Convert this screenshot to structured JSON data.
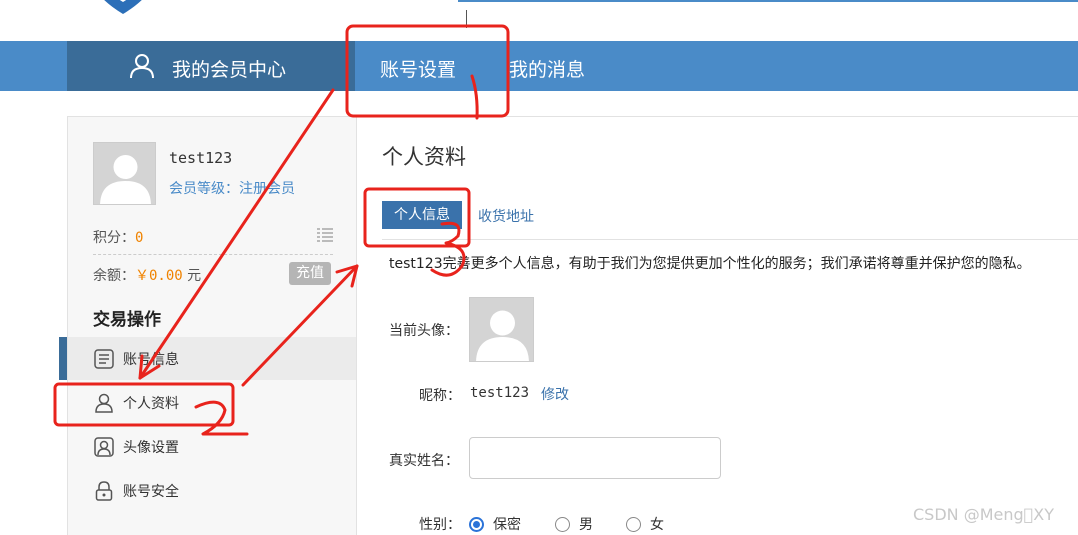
{
  "nav": {
    "home_label": "我的会员中心",
    "account_settings_label": "账号设置",
    "messages_label": "我的消息"
  },
  "sidebar": {
    "username": "test123",
    "level": "会员等级：注册会员",
    "points_label": "积分：",
    "points_value": "0",
    "balance_label": "余额：",
    "balance_value": "￥0.00",
    "balance_unit": "元",
    "recharge_label": "充值",
    "section_title": "交易操作",
    "items": [
      {
        "label": "账号信息",
        "icon": "account-info-icon"
      },
      {
        "label": "个人资料",
        "icon": "person-icon"
      },
      {
        "label": "头像设置",
        "icon": "portrait-icon"
      },
      {
        "label": "账号安全",
        "icon": "lock-icon"
      }
    ]
  },
  "main": {
    "title": "个人资料",
    "tabs": [
      {
        "label": "个人信息",
        "active": true
      },
      {
        "label": "收货地址",
        "active": false
      }
    ],
    "intro": "test123完善更多个人信息，有助于我们为您提供更加个性化的服务；我们承诺将尊重并保护您的隐私。",
    "avatar_label": "当前头像：",
    "nickname_label": "昵称：",
    "nickname_value": "test123",
    "modify_label": "修改",
    "realname_label": "真实姓名：",
    "realname_value": "",
    "gender_label": "性别：",
    "gender_options": [
      "保密",
      "男",
      "女"
    ],
    "gender_selected": "保密"
  },
  "annotations": [
    "1",
    "2",
    "3"
  ],
  "watermark": "CSDN @Meng\u0000XY",
  "colors": {
    "nav_blue": "#4a8bc8",
    "nav_dark": "#3a6c98",
    "accent_orange": "#f08300",
    "annotation_red": "#e8231c"
  }
}
